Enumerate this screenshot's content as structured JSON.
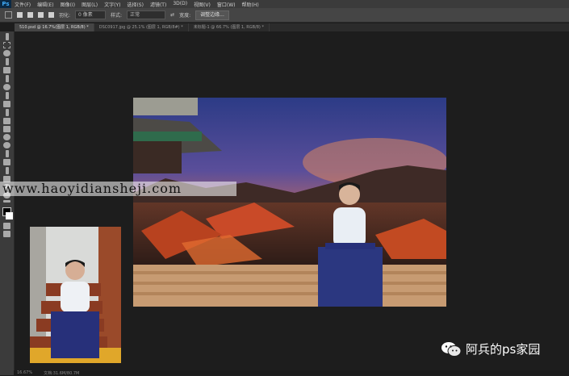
{
  "app": {
    "logo": "Ps"
  },
  "menu": [
    "文件(F)",
    "编辑(E)",
    "图像(I)",
    "图层(L)",
    "文字(Y)",
    "选择(S)",
    "滤镜(T)",
    "3D(D)",
    "视图(V)",
    "窗口(W)",
    "帮助(H)"
  ],
  "options": {
    "feather_label": "羽化:",
    "feather_value": "0 像素",
    "style_label": "样式:",
    "style_value": "正常",
    "width_label": "宽度:",
    "refine_button": "调整边缘..."
  },
  "tabs": [
    {
      "label": "510.psd @ 16.7%(图层 1, RGB/8) *",
      "active": true
    },
    {
      "label": "DSC0917.jpg @ 25.1% (图层 1, RGB/8#) *",
      "active": false
    },
    {
      "label": "未标题-1 @ 66.7% (图层 1, RGB/8) *",
      "active": false
    }
  ],
  "watermark": "www.haoyidiansheji.com",
  "brand": {
    "name": "阿兵的ps家园"
  },
  "status": {
    "zoom": "16.67%",
    "doc": "文档:31.6M/80.7M"
  },
  "colors": {
    "accent": "#3fa9f5",
    "swatch_fg": "#000000",
    "swatch_bg": "#ffffff"
  }
}
